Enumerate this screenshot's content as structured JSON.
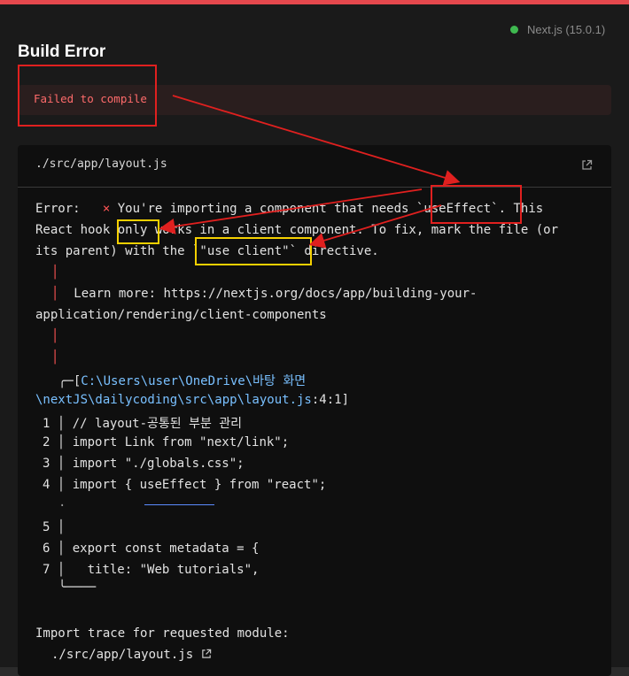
{
  "header": {
    "version": "Next.js (15.0.1)",
    "title": "Build Error",
    "failed": "Failed to compile"
  },
  "file": {
    "path": "./src/app/layout.js"
  },
  "error": {
    "prefix": "Error:",
    "x": "×",
    "line1": "You're importing a component that needs `useEffect`. This",
    "line2": "React hook only works in a client component. To fix, mark the file (or",
    "line3": "its parent) with the `\"use client\"` directive.",
    "learn1": "Learn more: https://nextjs.org/docs/app/building-your-",
    "learn2": "application/rendering/client-components",
    "loc1_prefix": "╭─[",
    "loc1_path": "C:\\Users\\user\\OneDrive\\바탕 화면",
    "loc2": "\\nextJS\\dailycoding\\src\\app\\layout.js",
    "loc2_suffix": ":4:1]"
  },
  "code": {
    "n1": "1",
    "l1": "// layout-공통된 부분 관리",
    "n2": "2",
    "l2": "import Link from \"next/link\";",
    "n3": "3",
    "l3": "import \"./globals.css\";",
    "n4": "4",
    "l4": "import { useEffect } from \"react\";",
    "n5": "5",
    "n6": "6",
    "l6": "export const metadata = {",
    "n7": "7",
    "l7": "  title: \"Web tutorials\","
  },
  "trace": {
    "title": "Import trace for requested module:",
    "path": "./src/app/layout.js"
  },
  "colors": {
    "accent": "#e5484d",
    "annotation_red": "#e0201f",
    "annotation_yellow": "#f5d000"
  }
}
